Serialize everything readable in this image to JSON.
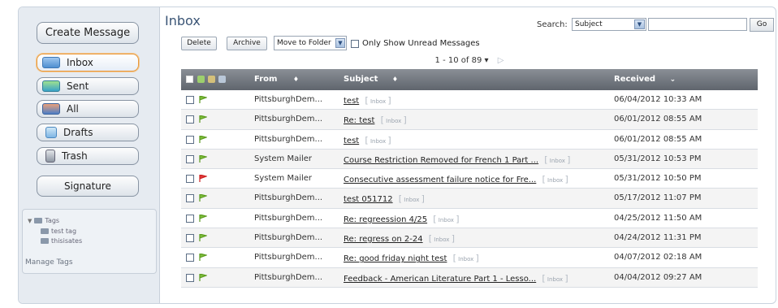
{
  "sidebar": {
    "create_message": "Create Message",
    "folders": [
      {
        "label": "Inbox",
        "icon": "inbox-icon",
        "active": true
      },
      {
        "label": "Sent",
        "icon": "sent-icon"
      },
      {
        "label": "All",
        "icon": "all-icon"
      },
      {
        "label": "Drafts",
        "icon": "drafts-icon"
      },
      {
        "label": "Trash",
        "icon": "trash-icon"
      }
    ],
    "signature": "Signature",
    "tags": {
      "header": "Tags",
      "items": [
        "test tag",
        "thisisates"
      ],
      "manage": "Manage Tags"
    }
  },
  "header": {
    "title": "Inbox",
    "search_label": "Search:",
    "search_field": "Subject",
    "search_value": "",
    "go": "Go"
  },
  "toolbar": {
    "delete": "Delete",
    "archive": "Archive",
    "move_to_folder": "Move to Folder",
    "only_unread": "Only Show Unread Messages"
  },
  "pager": {
    "text": "1 - 10 of 89",
    "caret": "▾",
    "next": "▷"
  },
  "columns": {
    "from": "From",
    "subject": "Subject",
    "received": "Received",
    "sort_icon": "♦",
    "sort_desc": "⌄"
  },
  "badge_label": "Inbox",
  "colors": {
    "flag_green": "#5a9a1e",
    "flag_red": "#cc1f1f",
    "accent": "#e8983a",
    "title": "#3a5475"
  },
  "messages": [
    {
      "from": "PittsburghDem...",
      "subject": "test",
      "folder": "Inbox",
      "received": "06/04/2012 10:33 AM",
      "flag": "green"
    },
    {
      "from": "PittsburghDem...",
      "subject": "Re: test",
      "folder": "Inbox",
      "received": "06/01/2012 08:55 AM",
      "flag": "green"
    },
    {
      "from": "PittsburghDem...",
      "subject": "test",
      "folder": "Inbox",
      "received": "06/01/2012 08:55 AM",
      "flag": "green"
    },
    {
      "from": "System Mailer",
      "subject": "Course Restriction Removed for French 1 Part ...",
      "folder": "Inbox",
      "received": "05/31/2012 10:53 PM",
      "flag": "green"
    },
    {
      "from": "System Mailer",
      "subject": "Consecutive assessment failure notice for Fre...",
      "folder": "Inbox",
      "received": "05/31/2012 10:50 PM",
      "flag": "red"
    },
    {
      "from": "PittsburghDem...",
      "subject": "test 051712",
      "folder": "Inbox",
      "received": "05/17/2012 11:07 PM",
      "flag": "green"
    },
    {
      "from": "PittsburghDem...",
      "subject": "Re: regreession 4/25",
      "folder": "Inbox",
      "received": "04/25/2012 11:50 AM",
      "flag": "green"
    },
    {
      "from": "PittsburghDem...",
      "subject": "Re: regress on 2-24",
      "folder": "Inbox",
      "received": "04/24/2012 11:31 PM",
      "flag": "green"
    },
    {
      "from": "PittsburghDem...",
      "subject": "Re: good friday night test",
      "folder": "Inbox",
      "received": "04/07/2012 02:18 AM",
      "flag": "green"
    },
    {
      "from": "PittsburghDem...",
      "subject": "Feedback - American Literature Part 1 - Lesso...",
      "folder": "Inbox",
      "received": "04/04/2012 09:27 AM",
      "flag": "green"
    }
  ]
}
